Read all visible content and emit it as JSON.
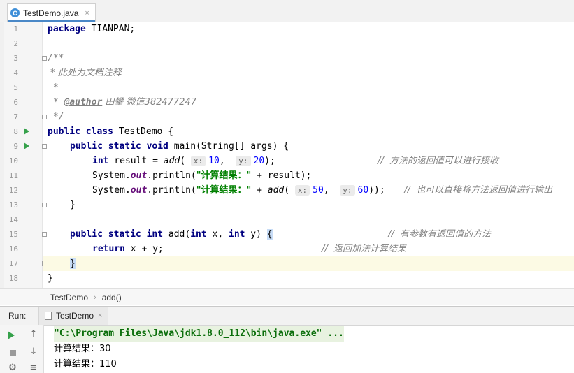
{
  "editor": {
    "tab_label": "TestDemo.java",
    "tab_icon": "C",
    "tab_close": "×",
    "line_numbers": [
      "1",
      "2",
      "3",
      "4",
      "5",
      "6",
      "7",
      "8",
      "9",
      "10",
      "11",
      "12",
      "13",
      "14",
      "15",
      "16",
      "17",
      "18"
    ],
    "lines": {
      "l1_kw": "package",
      "l1_rest": " TIANPAN;",
      "l3": "/**",
      "l4": " * 此处为文档注释",
      "l5": " *",
      "l6_pre": " * ",
      "l6_tag": "@author",
      "l6_rest": " 田攀 微信382477247",
      "l7": " */",
      "l8_kw": "public class",
      "l8_rest": " TestDemo {",
      "l9_kw": "public static void",
      "l9_rest": " main(String[] args) {",
      "l10_kw": "int",
      "l10_a": " result = ",
      "l10_call": "add",
      "l10_b": "( ",
      "l10_hx": "x:",
      "l10_n1": "10",
      "l10_c": ",  ",
      "l10_hy": "y:",
      "l10_n2": "20",
      "l10_d": ");",
      "l10_comment": "//  方法的返回值可以进行接收",
      "l11_a": "System.",
      "l11_out": "out",
      "l11_b": ".println(",
      "l11_str": "\"计算结果：\"",
      "l11_c": " + result);",
      "l12_a": "System.",
      "l12_out": "out",
      "l12_b": ".println(",
      "l12_str": "\"计算结果：\"",
      "l12_c": " + ",
      "l12_call": "add",
      "l12_d": "( ",
      "l12_hx": "x:",
      "l12_n1": "50",
      "l12_e": ",  ",
      "l12_hy": "y:",
      "l12_n2": "60",
      "l12_f": "));",
      "l12_comment": "//  也可以直接将方法返回值进行输出",
      "l13": "}",
      "l15_kw1": "public static int",
      "l15_a": " add(",
      "l15_kw2": "int",
      "l15_b": " x, ",
      "l15_kw3": "int",
      "l15_c": " y) ",
      "l15_brace": "{",
      "l15_comment": "//  有参数有返回值的方法",
      "l16_kw": "return",
      "l16_rest": " x + y;",
      "l16_comment": "//  返回加法计算结果",
      "l17_brace": "}",
      "l18": "}"
    }
  },
  "breadcrumb": {
    "items": [
      "TestDemo",
      "add()"
    ],
    "separator": "›"
  },
  "run_panel": {
    "label": "Run:",
    "tab_label": "TestDemo",
    "tab_close": "×",
    "output": [
      "\"C:\\Program Files\\Java\\jdk1.8.0_112\\bin\\java.exe\" ...",
      "计算结果：30",
      "计算结果：110"
    ],
    "tool_icons": [
      "play-icon",
      "stop-icon",
      "settings-icon",
      "up-arrow-icon",
      "down-arrow-icon",
      "wrap-icon"
    ]
  },
  "colors": {
    "keyword": "#000080",
    "string": "#008000",
    "number": "#0000ff",
    "comment": "#808080",
    "field": "#660e7a",
    "current_line": "#fcfae4",
    "run_green": "#36a14b",
    "tab_accent": "#4a88c7"
  }
}
